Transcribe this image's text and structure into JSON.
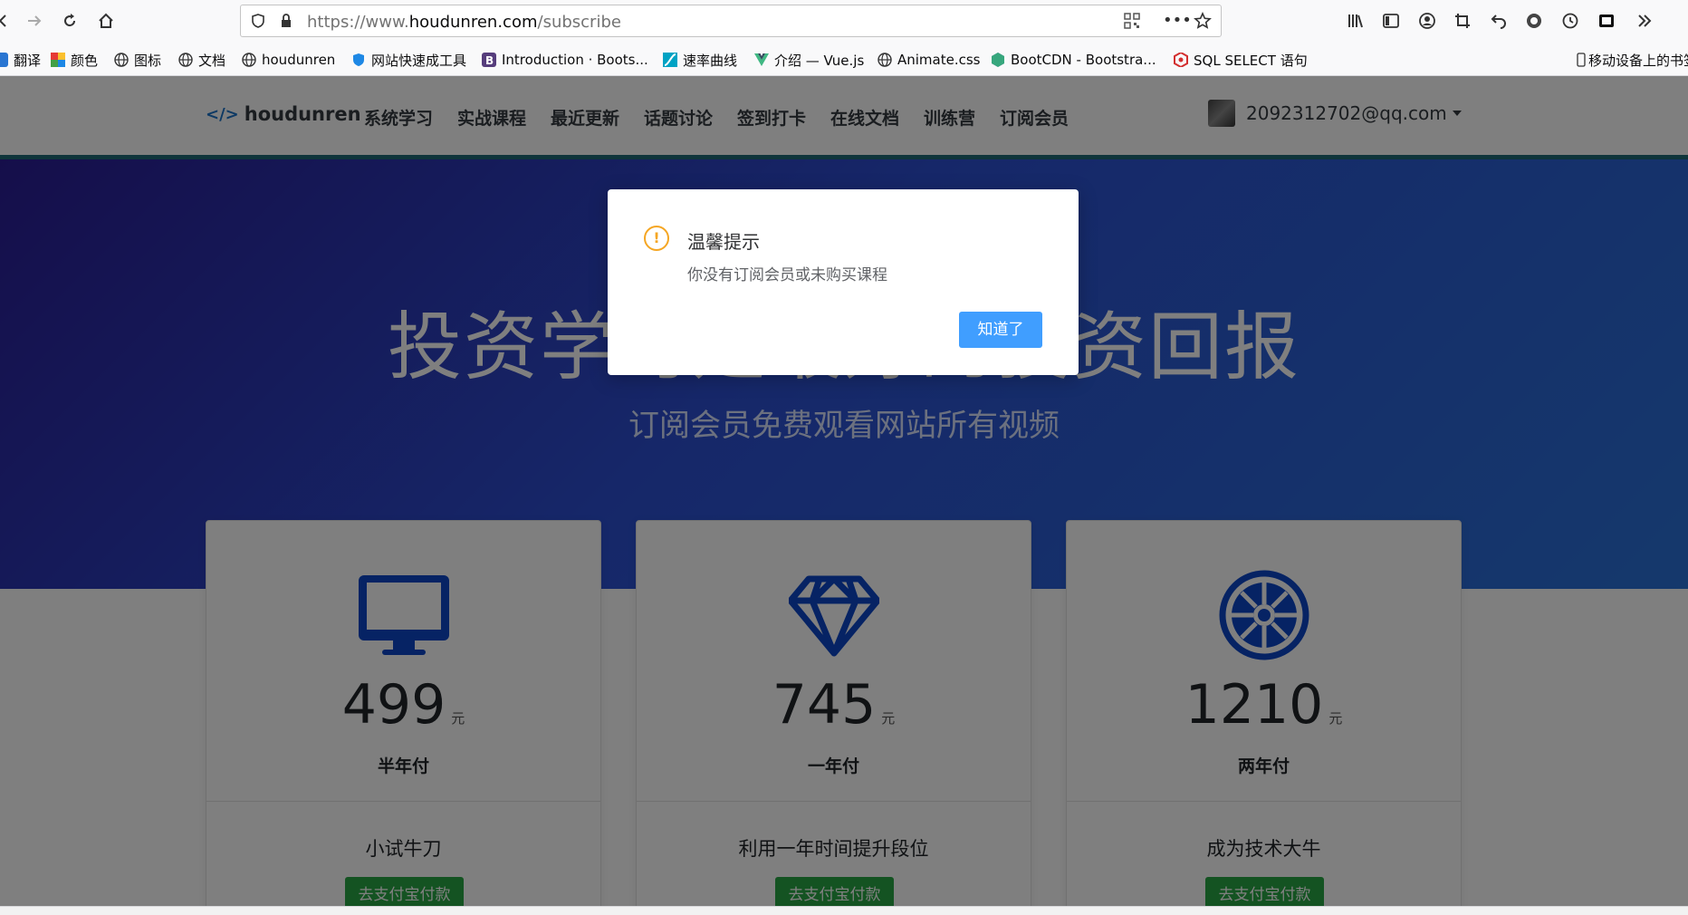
{
  "browser": {
    "url_prefix": "https://www.",
    "url_domain": "houdunren.com",
    "url_path": "/subscribe",
    "bookmarks": [
      {
        "label": "翻译",
        "icon": "translate-icon"
      },
      {
        "label": "颜色",
        "icon": "color-palette-icon"
      },
      {
        "label": "图标",
        "icon": "globe-icon"
      },
      {
        "label": "文档",
        "icon": "globe-icon"
      },
      {
        "label": "houdunren",
        "icon": "globe-icon"
      },
      {
        "label": "网站快速成工具",
        "icon": "shield-icon"
      },
      {
        "label": "Introduction · Boots...",
        "icon": "bootstrap-icon"
      },
      {
        "label": "速率曲线",
        "icon": "curve-icon"
      },
      {
        "label": "介绍 — Vue.js",
        "icon": "vue-icon"
      },
      {
        "label": "Animate.css",
        "icon": "globe-icon"
      },
      {
        "label": "BootCDN - Bootstra...",
        "icon": "cdn-icon"
      },
      {
        "label": "SQL SELECT 语句",
        "icon": "w3-icon"
      }
    ],
    "mobile_bookmarks": "移动设备上的书签"
  },
  "site": {
    "logo": "houdunren",
    "nav": [
      "系统学习",
      "实战课程",
      "最近更新",
      "话题讨论",
      "签到打卡",
      "在线文档",
      "训练营",
      "订阅会员"
    ],
    "user": "2092312702@qq.com"
  },
  "hero": {
    "title": "投资学习是最好的投资回报",
    "subtitle": "订阅会员免费观看网站所有视频"
  },
  "plans": [
    {
      "icon": "monitor-icon",
      "price": "499",
      "unit": "元",
      "period": "半年付",
      "desc": "小试牛刀",
      "button": "去支付宝付款"
    },
    {
      "icon": "diamond-icon",
      "price": "745",
      "unit": "元",
      "period": "一年付",
      "desc": "利用一年时间提升段位",
      "button": "去支付宝付款"
    },
    {
      "icon": "empire-icon",
      "price": "1210",
      "unit": "元",
      "period": "两年付",
      "desc": "成为技术大牛",
      "button": "去支付宝付款"
    }
  ],
  "modal": {
    "title": "温馨提示",
    "message": "你没有订阅会员或未购买课程",
    "button": "知道了"
  },
  "colors": {
    "hero_start": "#2a1d95",
    "hero_end": "#2a72d9",
    "plan_icon": "#0d47c9",
    "pay_button": "#28a745",
    "modal_button": "#409eff",
    "warning": "#f5a623"
  }
}
